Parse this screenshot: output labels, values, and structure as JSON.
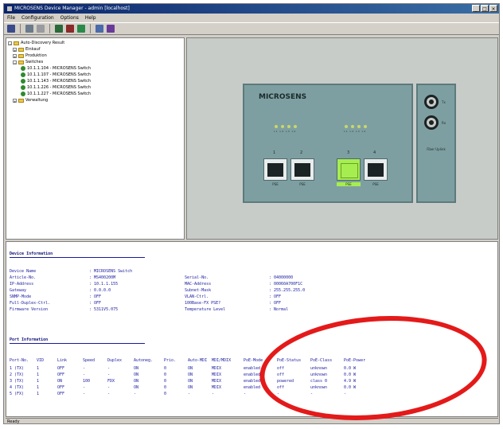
{
  "window": {
    "title": "MICROSENS Device Manager - admin [localhost]",
    "buttons": [
      "_",
      "□",
      "×"
    ]
  },
  "menu": [
    "File",
    "Configuration",
    "Options",
    "Help"
  ],
  "toolbar": {
    "icons": [
      "connect-icon",
      "open-icon",
      "close-icon",
      "save-icon",
      "refresh-icon",
      "chart-icon",
      "settings-icon",
      "help-icon"
    ]
  },
  "tree": {
    "root": "Auto-Discovery Result",
    "folders": [
      "Einkauf",
      "Produktion",
      "Switches"
    ],
    "switches": [
      "10.1.1.104 - MICROSENS Switch",
      "10.1.1.107 - MICROSENS Switch",
      "10.1.1.143 - MICROSENS Switch",
      "10.1.1.226 - MICROSENS Switch",
      "10.1.1.227 - MICROSENS Switch"
    ],
    "last_folder": "Verwaltung"
  },
  "device": {
    "brand": "MICROSENS",
    "led_labels_left": "L1 L2 L3 L4",
    "led_labels_right": "L1 L2 L3 L4",
    "port_numbers": [
      "1",
      "2",
      "3",
      "4"
    ],
    "port_labels": [
      "PSE",
      "PSE",
      "PSE",
      "PSE"
    ],
    "active_port_index": 2,
    "active_color": "#a6ee50",
    "fiber_labels": [
      "Tx",
      "Rx"
    ],
    "fiber_module": "Fiber Uplink"
  },
  "info": {
    "device_heading": "Device Information",
    "left_fields": [
      {
        "key": "Device Name",
        "value": ": MICROSENS Switch"
      },
      {
        "key": "Article-No.",
        "value": ": MS400200M"
      },
      {
        "key": "IP-Address",
        "value": ": 10.1.1.155"
      },
      {
        "key": "Gateway",
        "value": ": 0.0.0.0"
      },
      {
        "key": "SNMP-Mode",
        "value": ": OFF"
      },
      {
        "key": "Full-Duplex-Ctrl.",
        "value": ": OFF"
      },
      {
        "key": "Firmware Version",
        "value": ": 5311V5.075"
      }
    ],
    "right_fields": [
      {
        "key": "Serial-No.",
        "value": ": 04000000"
      },
      {
        "key": "MAC-Address",
        "value": ": 00060A700F1C"
      },
      {
        "key": "Subnet-Mask",
        "value": ": 255.255.255.0"
      },
      {
        "key": "VLAN-Ctrl.",
        "value": ": OFF"
      },
      {
        "key": "100Base-FX PSE?",
        "value": ": OFF"
      },
      {
        "key": "Temperature Level",
        "value": ": Normal"
      }
    ],
    "port_heading": "Port Information",
    "port_columns": [
      "Port-No.",
      "VID",
      "Link",
      "Speed",
      "Duplex",
      "Autoneg.",
      "Prio.",
      "Auto-MDI",
      "MDI/MDIX",
      "PoE-Mode",
      "PoE-Status",
      "PoE-Class",
      "PoE-Power"
    ],
    "port_rows": [
      [
        "1 (TX)",
        "1",
        "OFF",
        "-",
        "-",
        "ON",
        "0",
        "ON",
        "MDIX",
        "enabled",
        "off",
        "unknown",
        "0.0 W"
      ],
      [
        "2 (TX)",
        "1",
        "OFF",
        "-",
        "-",
        "ON",
        "0",
        "ON",
        "MDIX",
        "enabled",
        "off",
        "unknown",
        "0.0 W"
      ],
      [
        "3 (TX)",
        "1",
        "ON",
        "100",
        "FDX",
        "ON",
        "0",
        "ON",
        "MDIX",
        "enabled",
        "powered",
        "class 0",
        "4.9 W"
      ],
      [
        "4 (TX)",
        "1",
        "OFF",
        "-",
        "-",
        "ON",
        "0",
        "ON",
        "MDIX",
        "enabled",
        "off",
        "unknown",
        "0.0 W"
      ],
      [
        "5 (FX)",
        "1",
        "OFF",
        "-",
        "-",
        "-",
        "0",
        "-",
        "-",
        "-",
        "-",
        "-",
        "-"
      ]
    ]
  },
  "status_text": "Ready",
  "annotation_color": "#e41a1a"
}
